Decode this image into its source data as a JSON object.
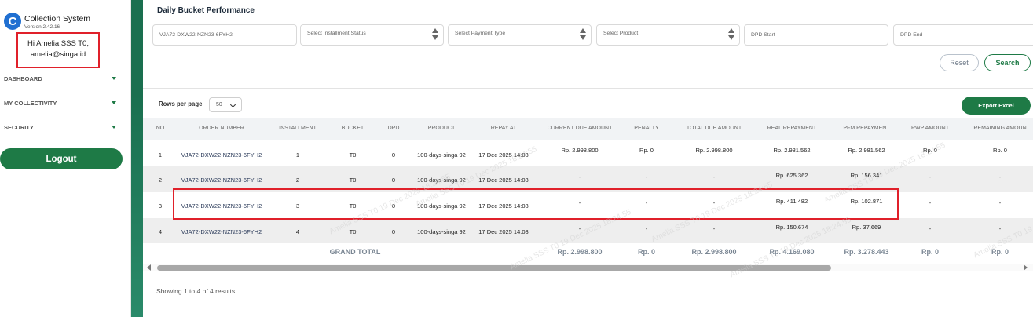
{
  "sidebar": {
    "app_title": "Collection System",
    "version": "Version 2.42.16",
    "greeting": "Hi Amelia SSS T0,",
    "email": "amelia@singa.id",
    "nav": [
      {
        "label": "DASHBOARD"
      },
      {
        "label": "MY COLLECTIVITY"
      },
      {
        "label": "SECURITY"
      }
    ],
    "logout_label": "Logout"
  },
  "main": {
    "title": "Daily Bucket Performance",
    "filters": {
      "order_number": "VJA72-DXW22-NZN23-6FYH2",
      "installment_status": "Select Installment Status",
      "payment_type": "Select Payment Type",
      "product": "Select Product",
      "dpd_start": "DPD Start",
      "dpd_end": "DPD End"
    },
    "reset_label": "Reset",
    "search_label": "Search",
    "rows_per_page_label": "Rows per page",
    "rows_per_page_value": "50",
    "export_label": "Export Excel",
    "footer": "Showing 1 to 4 of 4 results",
    "watermark": "Amelia SSS T0 19 Dec 2025 18:24:55"
  },
  "table": {
    "headers": [
      "NO",
      "ORDER NUMBER",
      "INSTALLMENT",
      "BUCKET",
      "DPD",
      "PRODUCT",
      "REPAY AT",
      "CURRENT DUE AMOUNT",
      "PENALTY",
      "TOTAL DUE AMOUNT",
      "REAL REPAYMENT",
      "PFM REPAYMENT",
      "RWP AMOUNT",
      "REMAINING AMOUN"
    ],
    "rows": [
      [
        "1",
        "VJA72-DXW22-NZN23-6FYH2",
        "1",
        "T0",
        "0",
        "100-days-singa 92",
        "17 Dec 2025 14:08",
        "Rp. 2.998.800",
        "Rp. 0",
        "Rp. 2.998.800",
        "Rp. 2.981.562",
        "Rp. 2.981.562",
        "Rp. 0",
        "Rp. 0"
      ],
      [
        "2",
        "VJA72-DXW22-NZN23-6FYH2",
        "2",
        "T0",
        "0",
        "100-days-singa 92",
        "17 Dec 2025 14:08",
        "-",
        "-",
        "-",
        "Rp. 625.362",
        "Rp. 156.341",
        "-",
        "-"
      ],
      [
        "3",
        "VJA72-DXW22-NZN23-6FYH2",
        "3",
        "T0",
        "0",
        "100-days-singa 92",
        "17 Dec 2025 14:08",
        "-",
        "-",
        "-",
        "Rp. 411.482",
        "Rp. 102.871",
        "-",
        "-"
      ],
      [
        "4",
        "VJA72-DXW22-NZN23-6FYH2",
        "4",
        "T0",
        "0",
        "100-days-singa 92",
        "17 Dec 2025 14:08",
        "-",
        "-",
        "-",
        "Rp. 150.674",
        "Rp. 37.669",
        "-",
        "-"
      ]
    ],
    "total": {
      "label": "GRAND TOTAL",
      "current_due": "Rp. 2.998.800",
      "penalty": "Rp. 0",
      "total_due": "Rp. 2.998.800",
      "real_repayment": "Rp. 4.169.080",
      "pfm_repayment": "Rp. 3.278.443",
      "rwp": "Rp. 0",
      "remaining": "Rp. 0"
    }
  },
  "colors": {
    "brand_green": "#1e7a46",
    "highlight_red": "#e0202a",
    "logo_blue": "#1f6fd1"
  }
}
